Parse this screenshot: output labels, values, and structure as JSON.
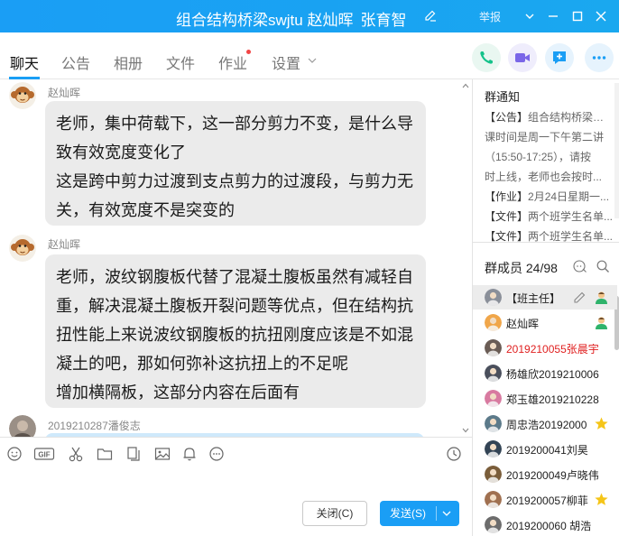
{
  "titlebar": {
    "group_name": "组合结构桥梁swjtu 赵灿晖",
    "sub_name": "张育智",
    "report_label": "举报"
  },
  "tabs": [
    {
      "label": "聊天"
    },
    {
      "label": "公告"
    },
    {
      "label": "相册"
    },
    {
      "label": "文件"
    },
    {
      "label": "作业"
    },
    {
      "label": "设置"
    }
  ],
  "messages": [
    {
      "sender": "赵灿晖",
      "lines": [
        "老师，集中荷载下，这一部分剪力不变，是什么导致有效宽度变化了",
        "这是跨中剪力过渡到支点剪力的过渡段，与剪力无关，有效宽度不是突变的"
      ]
    },
    {
      "sender": "赵灿晖",
      "lines": [
        "老师，波纹钢腹板代替了混凝土腹板虽然有减轻自重，解决混凝土腹板开裂问题等优点，但在结构抗扭性能上来说波纹钢腹板的抗扭刚度应该是不如混凝土的吧，那如何弥补这抗扭上的不足呢",
        "增加横隔板，这部分内容在后面有"
      ]
    },
    {
      "sender": "2019210287潘俊志",
      "lines": []
    }
  ],
  "buttons": {
    "close_label": "关闭(C)",
    "send_label": "发送(S)"
  },
  "notice": {
    "title": "群通知",
    "lines": [
      {
        "tag": "【公告】",
        "text": "组合结构桥梁的上"
      },
      {
        "tag": "",
        "text": "课时间是周一下午第二讲"
      },
      {
        "tag": "",
        "text": "（15:50-17:25），请按"
      },
      {
        "tag": "",
        "text": "时上线，老师也会按时..."
      },
      {
        "tag": "【作业】",
        "text": "2月24日星期一..."
      },
      {
        "tag": "【文件】",
        "text": "两个班学生名单..."
      },
      {
        "tag": "【文件】",
        "text": "两个班学生名单..."
      }
    ]
  },
  "members": {
    "title": "群成员 24/98",
    "list": [
      {
        "name": "【班主任】",
        "red": false,
        "badge": "person-green",
        "selected": true,
        "edit": true
      },
      {
        "name": "赵灿晖",
        "red": false,
        "badge": "person-green",
        "selected": false,
        "edit": false
      },
      {
        "name": "2019210055张晨宇",
        "red": true,
        "badge": "",
        "selected": false,
        "edit": false
      },
      {
        "name": "杨雄欣2019210006",
        "red": false,
        "badge": "",
        "selected": false,
        "edit": false
      },
      {
        "name": "郑玉雄2019210228",
        "red": false,
        "badge": "",
        "selected": false,
        "edit": false
      },
      {
        "name": "周忠浩20192000",
        "red": false,
        "badge": "star",
        "selected": false,
        "edit": false
      },
      {
        "name": "2019200041刘昊",
        "red": false,
        "badge": "",
        "selected": false,
        "edit": false
      },
      {
        "name": "2019200049卢晓伟",
        "red": false,
        "badge": "",
        "selected": false,
        "edit": false
      },
      {
        "name": "2019200057柳菲",
        "red": false,
        "badge": "star",
        "selected": false,
        "edit": false
      },
      {
        "name": "2019200060 胡浩",
        "red": false,
        "badge": "",
        "selected": false,
        "edit": false
      }
    ]
  },
  "colors": {
    "accent": "#1a9ef5",
    "phone_green": "#14c28a",
    "video_purple": "#7a66e8",
    "bubble_bg": "#ebebeb",
    "red_name": "#e02020"
  }
}
